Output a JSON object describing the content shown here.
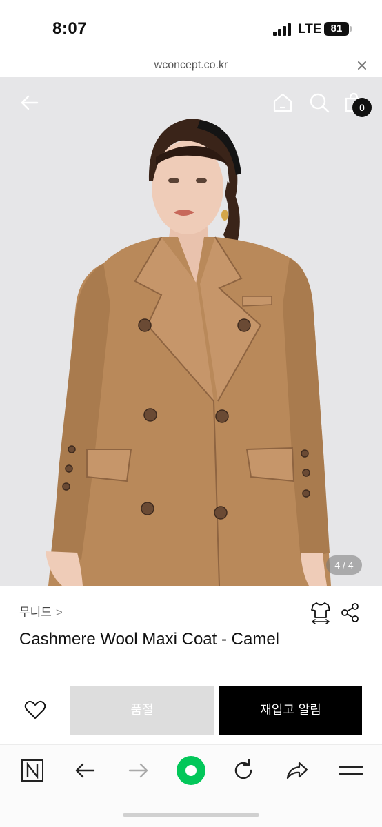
{
  "status_bar": {
    "time": "8:07",
    "network": "LTE",
    "battery": "81"
  },
  "browser": {
    "url": "wconcept.co.kr"
  },
  "hero": {
    "page_indicator": "4 / 4",
    "cart_count": "0"
  },
  "product": {
    "brand": "무니드",
    "brand_chevron": ">",
    "title": "Cashmere Wool Maxi Coat - Camel"
  },
  "actions": {
    "soldout_label": "품절",
    "restock_label": "재입고 알림"
  },
  "colors": {
    "coat": "#b9895a",
    "background": "#e6e6e8",
    "primary_button": "#000000",
    "disabled_button": "#dddddd",
    "naver_green": "#03c75a"
  },
  "icons": [
    "back-arrow-icon",
    "home-icon",
    "search-icon",
    "cart-icon",
    "size-guide-icon",
    "share-icon",
    "heart-icon",
    "naver-n-icon",
    "refresh-icon"
  ]
}
